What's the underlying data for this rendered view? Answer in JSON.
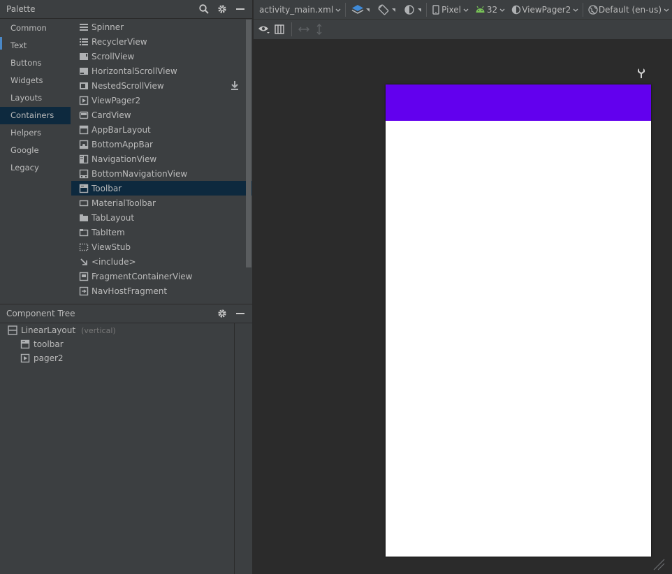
{
  "palette": {
    "title": "Palette",
    "categories": [
      {
        "label": "Common"
      },
      {
        "label": "Text"
      },
      {
        "label": "Buttons"
      },
      {
        "label": "Widgets"
      },
      {
        "label": "Layouts"
      },
      {
        "label": "Containers",
        "selected": true
      },
      {
        "label": "Helpers"
      },
      {
        "label": "Google"
      },
      {
        "label": "Legacy"
      }
    ],
    "widgets": [
      {
        "label": "Spinner",
        "icon": "spinner-icon"
      },
      {
        "label": "RecyclerView",
        "icon": "list-icon"
      },
      {
        "label": "ScrollView",
        "icon": "scrollview-icon"
      },
      {
        "label": "HorizontalScrollView",
        "icon": "hscroll-icon"
      },
      {
        "label": "NestedScrollView",
        "icon": "nested-scroll-icon",
        "download": true
      },
      {
        "label": "ViewPager2",
        "icon": "viewpager-icon"
      },
      {
        "label": "CardView",
        "icon": "card-icon"
      },
      {
        "label": "AppBarLayout",
        "icon": "appbar-icon"
      },
      {
        "label": "BottomAppBar",
        "icon": "bottom-appbar-icon"
      },
      {
        "label": "NavigationView",
        "icon": "navigation-icon"
      },
      {
        "label": "BottomNavigationView",
        "icon": "bottom-nav-icon"
      },
      {
        "label": "Toolbar",
        "icon": "toolbar-icon",
        "selected": true
      },
      {
        "label": "MaterialToolbar",
        "icon": "material-toolbar-icon"
      },
      {
        "label": "TabLayout",
        "icon": "tablayout-icon"
      },
      {
        "label": "TabItem",
        "icon": "tabitem-icon"
      },
      {
        "label": "ViewStub",
        "icon": "viewstub-icon"
      },
      {
        "label": "<include>",
        "icon": "include-arrow-icon"
      },
      {
        "label": "FragmentContainerView",
        "icon": "fragment-container-icon"
      },
      {
        "label": "NavHostFragment",
        "icon": "navhost-icon"
      }
    ]
  },
  "component_tree": {
    "title": "Component Tree",
    "root": {
      "label": "LinearLayout",
      "hint": "(vertical)"
    },
    "children": [
      {
        "label": "toolbar",
        "icon": "toolbar-icon"
      },
      {
        "label": "pager2",
        "icon": "viewpager-icon"
      }
    ]
  },
  "editor_toolbar": {
    "file": "activity_main.xml",
    "device": "Pixel",
    "api": "32",
    "theme": "ViewPager2",
    "locale": "Default (en-us)"
  },
  "colors": {
    "app_bar": "#6200ee",
    "android_green": "#78c257",
    "design_icon_blue": "#3f8ad7"
  }
}
